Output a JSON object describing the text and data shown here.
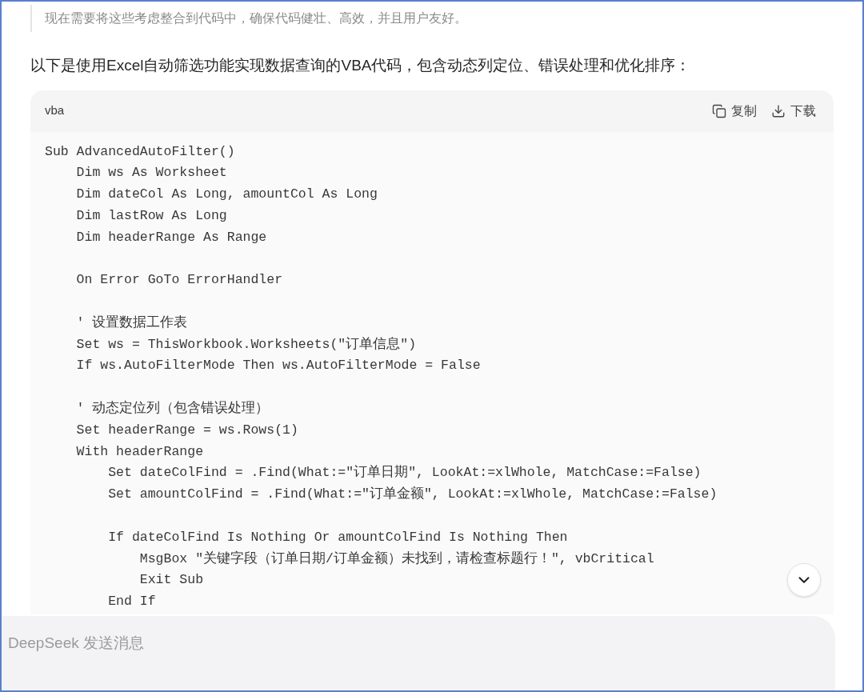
{
  "quote": "现在需要将这些考虑整合到代码中，确保代码健壮、高效，并且用户友好。",
  "intro": "以下是使用Excel自动筛选功能实现数据查询的VBA代码，包含动态列定位、错误处理和优化排序：",
  "code_block": {
    "language": "vba",
    "actions": [
      {
        "kind": "copy",
        "label": "复制"
      },
      {
        "kind": "download",
        "label": "下载"
      }
    ],
    "blocks": [
      [
        "Sub AdvancedAutoFilter()",
        "    Dim ws As Worksheet",
        "    Dim dateCol As Long, amountCol As Long",
        "    Dim lastRow As Long",
        "    Dim headerRange As Range"
      ],
      [
        "    On Error GoTo ErrorHandler"
      ],
      [
        "    ' 设置数据工作表",
        "    Set ws = ThisWorkbook.Worksheets(\"订单信息\")",
        "    If ws.AutoFilterMode Then ws.AutoFilterMode = False"
      ],
      [
        "    ' 动态定位列（包含错误处理）",
        "    Set headerRange = ws.Rows(1)",
        "    With headerRange",
        "        Set dateColFind = .Find(What:=\"订单日期\", LookAt:=xlWhole, MatchCase:=False)",
        "        Set amountColFind = .Find(What:=\"订单金额\", LookAt:=xlWhole, MatchCase:=False)"
      ],
      [
        "        If dateColFind Is Nothing Or amountColFind Is Nothing Then",
        "            MsgBox \"关键字段（订单日期/订单金额）未找到，请检查标题行！\", vbCritical",
        "            Exit Sub",
        "        End If"
      ]
    ]
  },
  "message_input": {
    "placeholder": "DeepSeek 发送消息"
  }
}
